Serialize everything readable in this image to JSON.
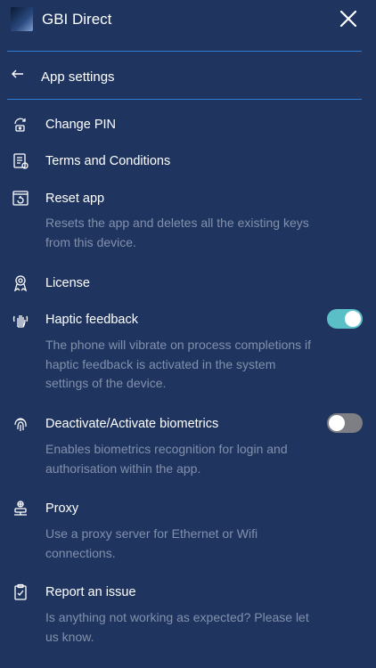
{
  "header": {
    "title": "GBI Direct",
    "logo_alt": "GBI Direct logo"
  },
  "back": {
    "label": "App settings"
  },
  "items": [
    {
      "label": "Change PIN",
      "icon": "change-pin-icon"
    },
    {
      "label": "Terms and Conditions",
      "icon": "document-icon"
    },
    {
      "label": "Reset app",
      "icon": "reset-icon",
      "desc": [
        "Resets the app and deletes all the existing keys",
        "from this device."
      ]
    },
    {
      "label": "License",
      "icon": "license-icon"
    },
    {
      "label": "Haptic feedback",
      "icon": "haptic-icon",
      "toggle": true,
      "desc": [
        "The phone will vibrate on process completions if",
        "haptic feedback is activated in the system",
        "settings of the device."
      ]
    },
    {
      "label": "Deactivate/Activate biometrics",
      "icon": "fingerprint-icon",
      "toggle": false,
      "desc": [
        "Enables biometrics recognition for login and",
        "authorisation within the app."
      ]
    },
    {
      "label": "Proxy",
      "icon": "proxy-icon",
      "desc": [
        "Use a proxy server for Ethernet or Wifi",
        "connections."
      ]
    },
    {
      "label": "Report an issue",
      "icon": "report-icon",
      "desc": [
        "Is anything not working as expected? Please let",
        "us know."
      ]
    }
  ],
  "colors": {
    "background": "#1f3560",
    "divider": "#2e7bd1",
    "toggle_on": "#5bbfc7",
    "toggle_off": "#7d7f85",
    "desc_text": "#8290ab"
  }
}
